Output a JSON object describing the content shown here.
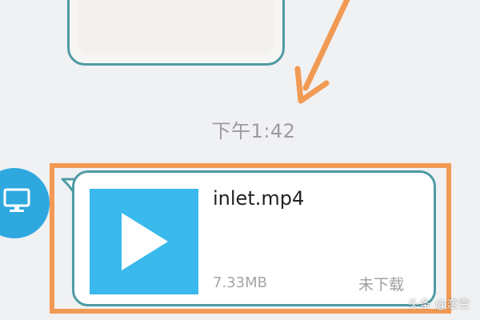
{
  "chat": {
    "timestamp": "下午1:42",
    "message": {
      "sender_icon": "monitor-icon",
      "file": {
        "name": "inlet.mp4",
        "size": "7.33MB",
        "status": "未下载",
        "thumbnail_icon": "play-icon"
      }
    }
  },
  "overlay": {
    "annotation_color": "#f19a54",
    "watermark": "头条 @恋空"
  },
  "colors": {
    "bubble_border": "#4f9ba4",
    "thumbnail_bg": "#3ab9ec",
    "avatar_bg": "#2fa8e0"
  }
}
